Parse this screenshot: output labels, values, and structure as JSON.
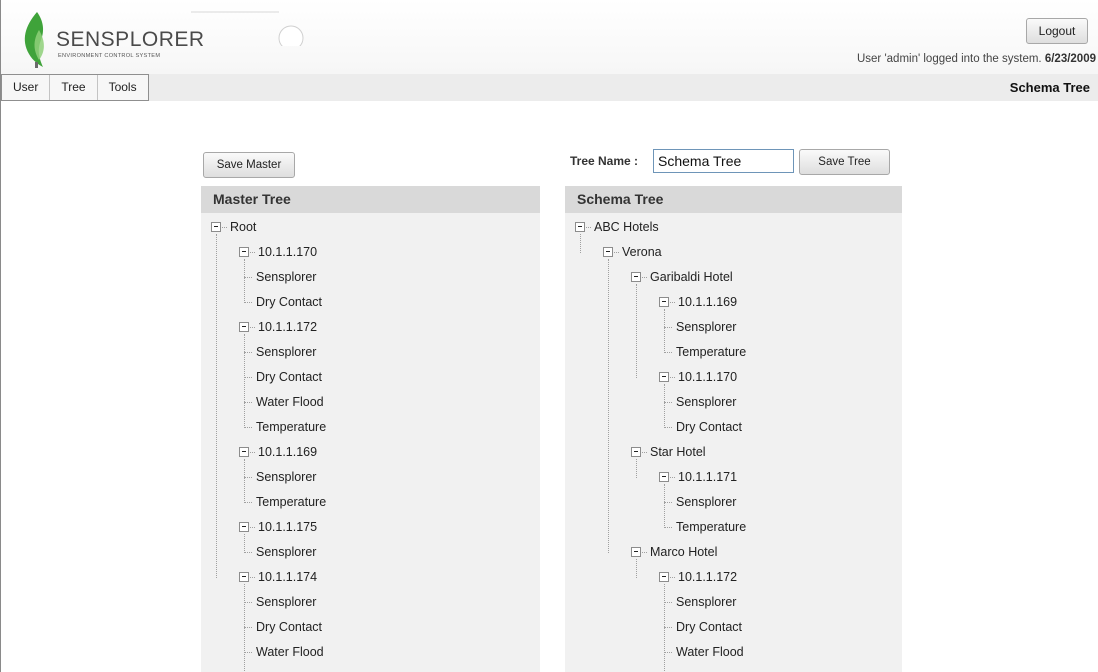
{
  "header": {
    "brand_name": "SENSPLORER",
    "brand_sub": "ENVIRONMENT CONTROL SYSTEM",
    "logout_label": "Logout",
    "login_text": "User 'admin' logged into the system. ",
    "login_date": "6/23/2009"
  },
  "menu": {
    "items": [
      "User",
      "Tree",
      "Tools"
    ],
    "page_heading": "Schema Tree"
  },
  "toolbar": {
    "save_master_label": "Save Master",
    "tree_name_label": "Tree Name :",
    "tree_name_value": "Schema Tree",
    "save_tree_label": "Save Tree"
  },
  "master_tree": {
    "title": "Master Tree",
    "nodes": [
      {
        "label": "Root",
        "level": 0,
        "expandable": true
      },
      {
        "label": "10.1.1.170",
        "level": 1,
        "expandable": true
      },
      {
        "label": "Sensplorer",
        "level": 2,
        "expandable": false
      },
      {
        "label": "Dry Contact",
        "level": 2,
        "expandable": false
      },
      {
        "label": "10.1.1.172",
        "level": 1,
        "expandable": true
      },
      {
        "label": "Sensplorer",
        "level": 2,
        "expandable": false
      },
      {
        "label": "Dry Contact",
        "level": 2,
        "expandable": false
      },
      {
        "label": "Water Flood",
        "level": 2,
        "expandable": false
      },
      {
        "label": "Temperature",
        "level": 2,
        "expandable": false
      },
      {
        "label": "10.1.1.169",
        "level": 1,
        "expandable": true
      },
      {
        "label": "Sensplorer",
        "level": 2,
        "expandable": false
      },
      {
        "label": "Temperature",
        "level": 2,
        "expandable": false
      },
      {
        "label": "10.1.1.175",
        "level": 1,
        "expandable": true
      },
      {
        "label": "Sensplorer",
        "level": 2,
        "expandable": false
      },
      {
        "label": "10.1.1.174",
        "level": 1,
        "expandable": true
      },
      {
        "label": "Sensplorer",
        "level": 2,
        "expandable": false
      },
      {
        "label": "Dry Contact",
        "level": 2,
        "expandable": false
      },
      {
        "label": "Water Flood",
        "level": 2,
        "expandable": false
      }
    ]
  },
  "schema_tree": {
    "title": "Schema Tree",
    "nodes": [
      {
        "label": "ABC Hotels",
        "level": 0,
        "expandable": true
      },
      {
        "label": "Verona",
        "level": 1,
        "expandable": true
      },
      {
        "label": "Garibaldi Hotel",
        "level": 2,
        "expandable": true
      },
      {
        "label": "10.1.1.169",
        "level": 3,
        "expandable": true
      },
      {
        "label": "Sensplorer",
        "level": 4,
        "expandable": false
      },
      {
        "label": "Temperature",
        "level": 4,
        "expandable": false
      },
      {
        "label": "10.1.1.170",
        "level": 3,
        "expandable": true
      },
      {
        "label": "Sensplorer",
        "level": 4,
        "expandable": false
      },
      {
        "label": "Dry Contact",
        "level": 4,
        "expandable": false
      },
      {
        "label": "Star Hotel",
        "level": 2,
        "expandable": true
      },
      {
        "label": "10.1.1.171",
        "level": 3,
        "expandable": true
      },
      {
        "label": "Sensplorer",
        "level": 4,
        "expandable": false
      },
      {
        "label": "Temperature",
        "level": 4,
        "expandable": false
      },
      {
        "label": "Marco Hotel",
        "level": 2,
        "expandable": true
      },
      {
        "label": "10.1.1.172",
        "level": 3,
        "expandable": true
      },
      {
        "label": "Sensplorer",
        "level": 4,
        "expandable": false
      },
      {
        "label": "Dry Contact",
        "level": 4,
        "expandable": false
      },
      {
        "label": "Water Flood",
        "level": 4,
        "expandable": false
      }
    ]
  },
  "colors": {
    "panel_bg": "#f1f1f1",
    "panel_header_bg": "#d9d9d9",
    "logo_green": "#3fa33a"
  }
}
